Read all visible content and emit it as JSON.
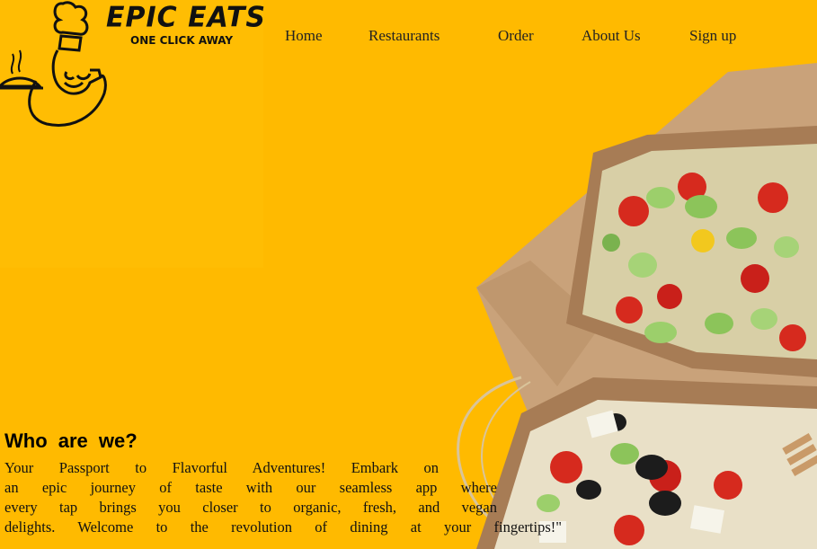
{
  "logo": {
    "title": "EPIC  EATS",
    "tagline": "ONE CLICK AWAY"
  },
  "nav": {
    "items": [
      {
        "label": "Home"
      },
      {
        "label": "Restaurants"
      },
      {
        "label": "Order"
      },
      {
        "label": "About Us"
      },
      {
        "label": "Sign up"
      }
    ]
  },
  "about": {
    "heading": "Who are we?",
    "lines": [
      "Your Passport to Flavorful Adventures! Embark on",
      "an epic journey of taste with our seamless app where",
      "every tap brings you closer to organic, fresh, and vegan",
      "delights. Welcome to the revolution of dining at your fingertips!\""
    ]
  },
  "colors": {
    "background": "#ffba00",
    "logo_panel": "#ffbd03",
    "text": "#111111"
  },
  "icons": [
    "chef-logo-icon",
    "salad-boxes-photo"
  ]
}
